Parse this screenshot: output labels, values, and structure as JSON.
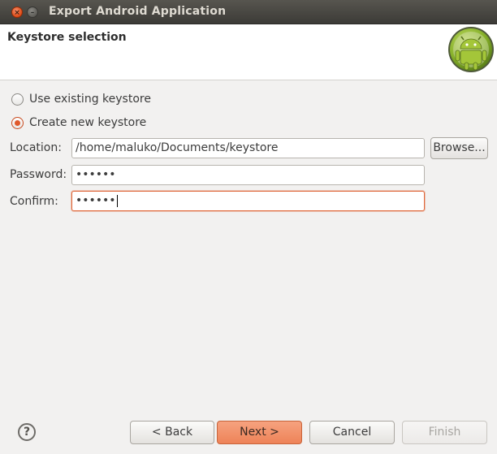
{
  "window": {
    "title": "Export Android Application",
    "close_glyph": "×",
    "minimize_glyph": "–"
  },
  "header": {
    "title": "Keystore selection",
    "logo_icon": "android-icon"
  },
  "options": {
    "use_existing": "Use existing keystore",
    "create_new": "Create new keystore",
    "selected": "create_new"
  },
  "form": {
    "location_label": "Location:",
    "location_value": "/home/maluko/Documents/keystore",
    "browse_label": "Browse...",
    "password_label": "Password:",
    "password_value": "••••••",
    "confirm_label": "Confirm:",
    "confirm_value": "••••••"
  },
  "footer": {
    "help_glyph": "?",
    "back_label": "< Back",
    "next_label": "Next >",
    "cancel_label": "Cancel",
    "finish_label": "Finish"
  },
  "colors": {
    "accent": "#e0592c",
    "titlebar": "#3c3b37",
    "android_green": "#a4c639"
  }
}
